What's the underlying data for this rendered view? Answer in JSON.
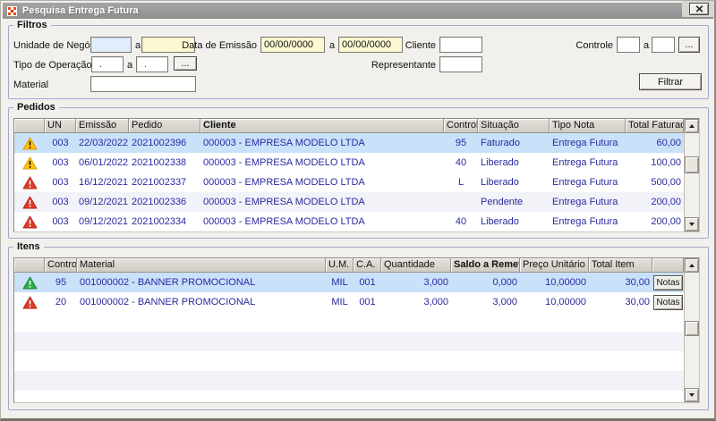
{
  "window": {
    "title": "Pesquisa Entrega Futura"
  },
  "filters": {
    "group_label": "Filtros",
    "range_separator": "a",
    "ellipsis_button": "...",
    "unidade_negocio": {
      "label": "Unidade de Negócio",
      "from": "",
      "to": ""
    },
    "data_emissao": {
      "label": "Data de Emissão",
      "from": "00/00/0000",
      "to": "00/00/0000"
    },
    "cliente": {
      "label": "Cliente",
      "value": ""
    },
    "controle": {
      "label": "Controle",
      "from": "",
      "to": ""
    },
    "tipo_operacao": {
      "label": "Tipo de Operação",
      "from": ".",
      "to": "."
    },
    "representante": {
      "label": "Representante",
      "value": ""
    },
    "material": {
      "label": "Material",
      "value": ""
    },
    "filtrar_button": "Filtrar"
  },
  "pedidos": {
    "group_label": "Pedidos",
    "columns": [
      "",
      "UN",
      "Emissão",
      "Pedido",
      "Cliente",
      "Controle",
      "Situação",
      "Tipo Nota",
      "Total Faturado"
    ],
    "rows": [
      {
        "icon": "warning-yellow",
        "un": "003",
        "emissao": "22/03/2022",
        "pedido": "2021002396",
        "cliente": "000003 - EMPRESA MODELO LTDA",
        "controle": "95",
        "situacao": "Faturado",
        "tipo_nota": "Entrega Futura",
        "total_faturado": "60,00",
        "selected": true
      },
      {
        "icon": "warning-yellow",
        "un": "003",
        "emissao": "06/01/2022",
        "pedido": "2021002338",
        "cliente": "000003 - EMPRESA MODELO LTDA",
        "controle": "40",
        "situacao": "Liberado",
        "tipo_nota": "Entrega Futura",
        "total_faturado": "100,00",
        "selected": false
      },
      {
        "icon": "warning-red",
        "un": "003",
        "emissao": "16/12/2021",
        "pedido": "2021002337",
        "cliente": "000003 - EMPRESA MODELO LTDA",
        "controle": "L",
        "situacao": "Liberado",
        "tipo_nota": "Entrega Futura",
        "total_faturado": "500,00",
        "selected": false
      },
      {
        "icon": "warning-red",
        "un": "003",
        "emissao": "09/12/2021",
        "pedido": "2021002336",
        "cliente": "000003 - EMPRESA MODELO LTDA",
        "controle": "",
        "situacao": "Pendente",
        "tipo_nota": "Entrega Futura",
        "total_faturado": "200,00",
        "selected": false
      },
      {
        "icon": "warning-red",
        "un": "003",
        "emissao": "09/12/2021",
        "pedido": "2021002334",
        "cliente": "000003 - EMPRESA MODELO LTDA",
        "controle": "40",
        "situacao": "Liberado",
        "tipo_nota": "Entrega Futura",
        "total_faturado": "200,00",
        "selected": false
      }
    ]
  },
  "itens": {
    "group_label": "Itens",
    "columns": [
      "",
      "Controle",
      "Material",
      "U.M.",
      "C.A.",
      "Quantidade",
      "Saldo a Remeter",
      "Preço Unitário",
      "Total Item",
      ""
    ],
    "rows": [
      {
        "icon": "ok-green",
        "controle": "95",
        "material": "001000002 - BANNER PROMOCIONAL",
        "um": "MIL",
        "ca": "001",
        "quantidade": "3,000",
        "saldo_a_remeter": "0,000",
        "preco_unitario": "10,00000",
        "total_item": "30,00",
        "button": "Notas",
        "selected": true
      },
      {
        "icon": "warning-red",
        "controle": "20",
        "material": "001000002 - BANNER PROMOCIONAL",
        "um": "MIL",
        "ca": "001",
        "quantidade": "3,000",
        "saldo_a_remeter": "3,000",
        "preco_unitario": "10,00000",
        "total_item": "30,00",
        "button": "Notas",
        "selected": false
      }
    ]
  },
  "colors": {
    "selection_bg": "#cae1fa",
    "row_text": "#2a2aa0",
    "warning_yellow": "#ffc20e",
    "danger_red": "#e03a28",
    "success_green": "#2ead49",
    "titlebar_gray": "#989898",
    "group_border": "#a6a6cf"
  }
}
